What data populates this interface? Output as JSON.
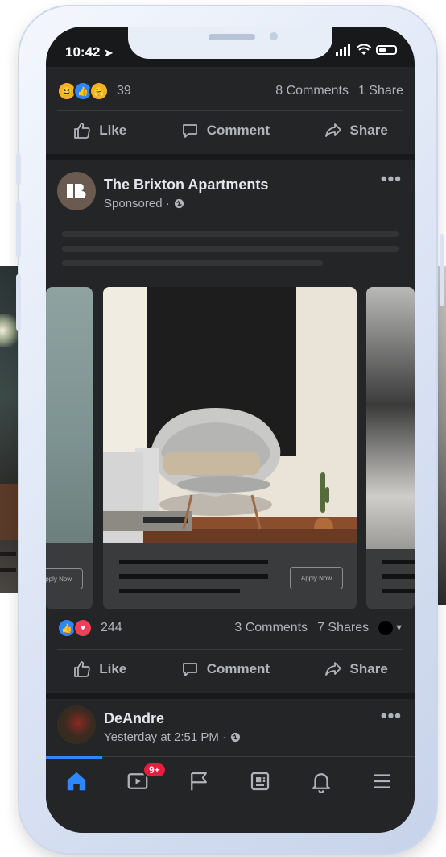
{
  "status_bar": {
    "time": "10:42"
  },
  "post1": {
    "reaction_count": "39",
    "comments": "8 Comments",
    "shares": "1 Share"
  },
  "actions": {
    "like": "Like",
    "comment": "Comment",
    "share": "Share"
  },
  "sponsored_post": {
    "page_name": "The Brixton Apartments",
    "page_initials": "B",
    "sponsored_label": "Sponsored ·",
    "cta_label": "Apply Now",
    "reaction_count": "244",
    "comments": "3 Comments",
    "shares": "7 Shares"
  },
  "post2": {
    "author": "DeAndre",
    "timestamp": "Yesterday at 2:51 PM ·"
  },
  "tabbar": {
    "video_badge": "9+",
    "tabs": [
      "home-icon",
      "video-icon",
      "flag-icon",
      "news-icon",
      "bell-icon",
      "menu-icon"
    ]
  },
  "colors": {
    "background": "#18191a",
    "card": "#242526",
    "text_primary": "#e4e6eb",
    "text_secondary": "#b0b3b8",
    "accent": "#2d88ff",
    "badge": "#e41e3f"
  }
}
